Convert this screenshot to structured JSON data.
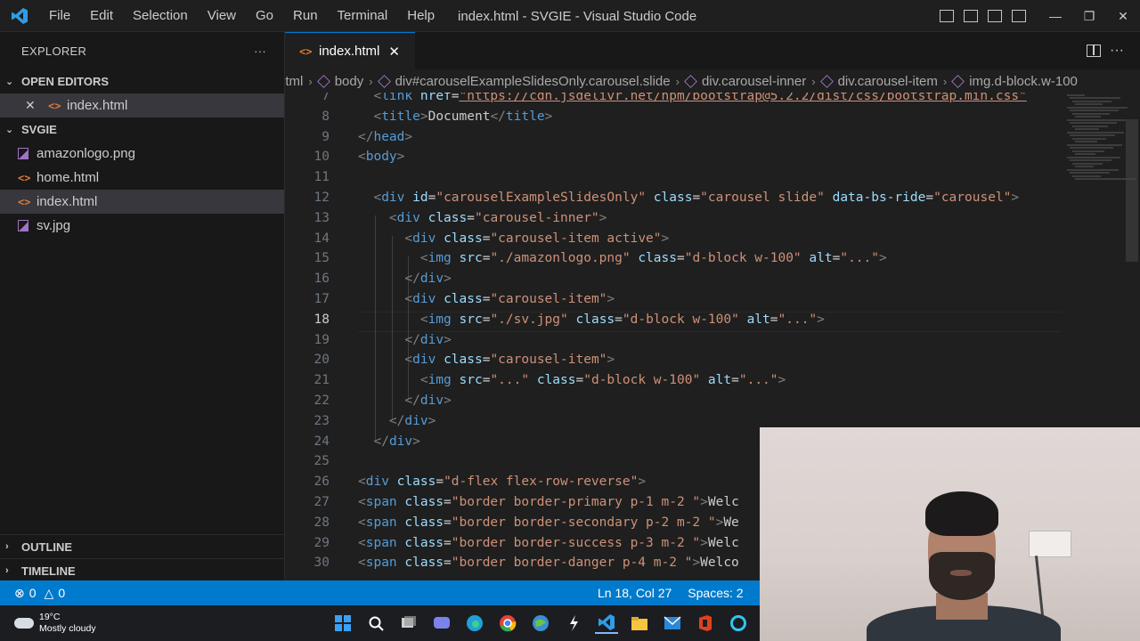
{
  "window": {
    "title": "index.html - SVGIE - Visual Studio Code",
    "menu": [
      "File",
      "Edit",
      "Selection",
      "View",
      "Go",
      "Run",
      "Terminal",
      "Help"
    ]
  },
  "explorer": {
    "header": "EXPLORER",
    "more": "···",
    "open_editors": {
      "title": "OPEN EDITORS",
      "items": [
        "index.html"
      ]
    },
    "folder": {
      "title": "SVGIE",
      "files": [
        {
          "name": "amazonlogo.png",
          "icon": "image-file-icon"
        },
        {
          "name": "home.html",
          "icon": "html-file-icon"
        },
        {
          "name": "index.html",
          "icon": "html-file-icon",
          "selected": true
        },
        {
          "name": "sv.jpg",
          "icon": "image-file-icon"
        }
      ]
    },
    "outline": "OUTLINE",
    "timeline": "TIMELINE"
  },
  "tab": {
    "label": "index.html",
    "close": "✕",
    "html_glyph": "<>"
  },
  "breadcrumb": [
    "html",
    "body",
    "div#carouselExampleSlidesOnly.carousel.slide",
    "div.carousel-inner",
    "div.carousel-item",
    "img.d-block.w-100"
  ],
  "editor": {
    "current_line": 18,
    "line_numbers": [
      7,
      8,
      9,
      10,
      11,
      12,
      13,
      14,
      15,
      16,
      17,
      18,
      19,
      20,
      21,
      22,
      23,
      24,
      25,
      26,
      27,
      28,
      29,
      30
    ],
    "lines": [
      "  <link href=\"https://cdn.jsdelivr.net/npm/bootstrap@5.2.2/dist/css/bootstrap.min.css\"",
      "  <title>Document</title>",
      "</head>",
      "<body>",
      "",
      "  <div id=\"carouselExampleSlidesOnly\" class=\"carousel slide\" data-bs-ride=\"carousel\">",
      "    <div class=\"carousel-inner\">",
      "      <div class=\"carousel-item active\">",
      "        <img src=\"./amazonlogo.png\" class=\"d-block w-100\" alt=\"...\">",
      "      </div>",
      "      <div class=\"carousel-item\">",
      "        <img src=\"./sv.jpg\" class=\"d-block w-100\" alt=\"...\">",
      "      </div>",
      "      <div class=\"carousel-item\">",
      "        <img src=\"...\" class=\"d-block w-100\" alt=\"...\">",
      "      </div>",
      "    </div>",
      "  </div>",
      "",
      "<div class=\"d-flex flex-row-reverse\">",
      "<span class=\"border border-primary p-1 m-2 \">Welc",
      "<span class=\"border border-secondary p-2 m-2 \">We",
      "<span class=\"border border-success p-3 m-2 \">Welc",
      "<span class=\"border border-danger p-4 m-2 \">Welco"
    ]
  },
  "status": {
    "errors": "0",
    "warnings": "0",
    "position": "Ln 18, Col 27",
    "spaces": "Spaces: 2"
  },
  "taskbar": {
    "temp": "19°C",
    "weather": "Mostly cloudy"
  },
  "colors": {
    "statusbar": "#007acc",
    "tag": "#569cd6",
    "attr": "#9cdcfe",
    "value": "#ce9178"
  }
}
